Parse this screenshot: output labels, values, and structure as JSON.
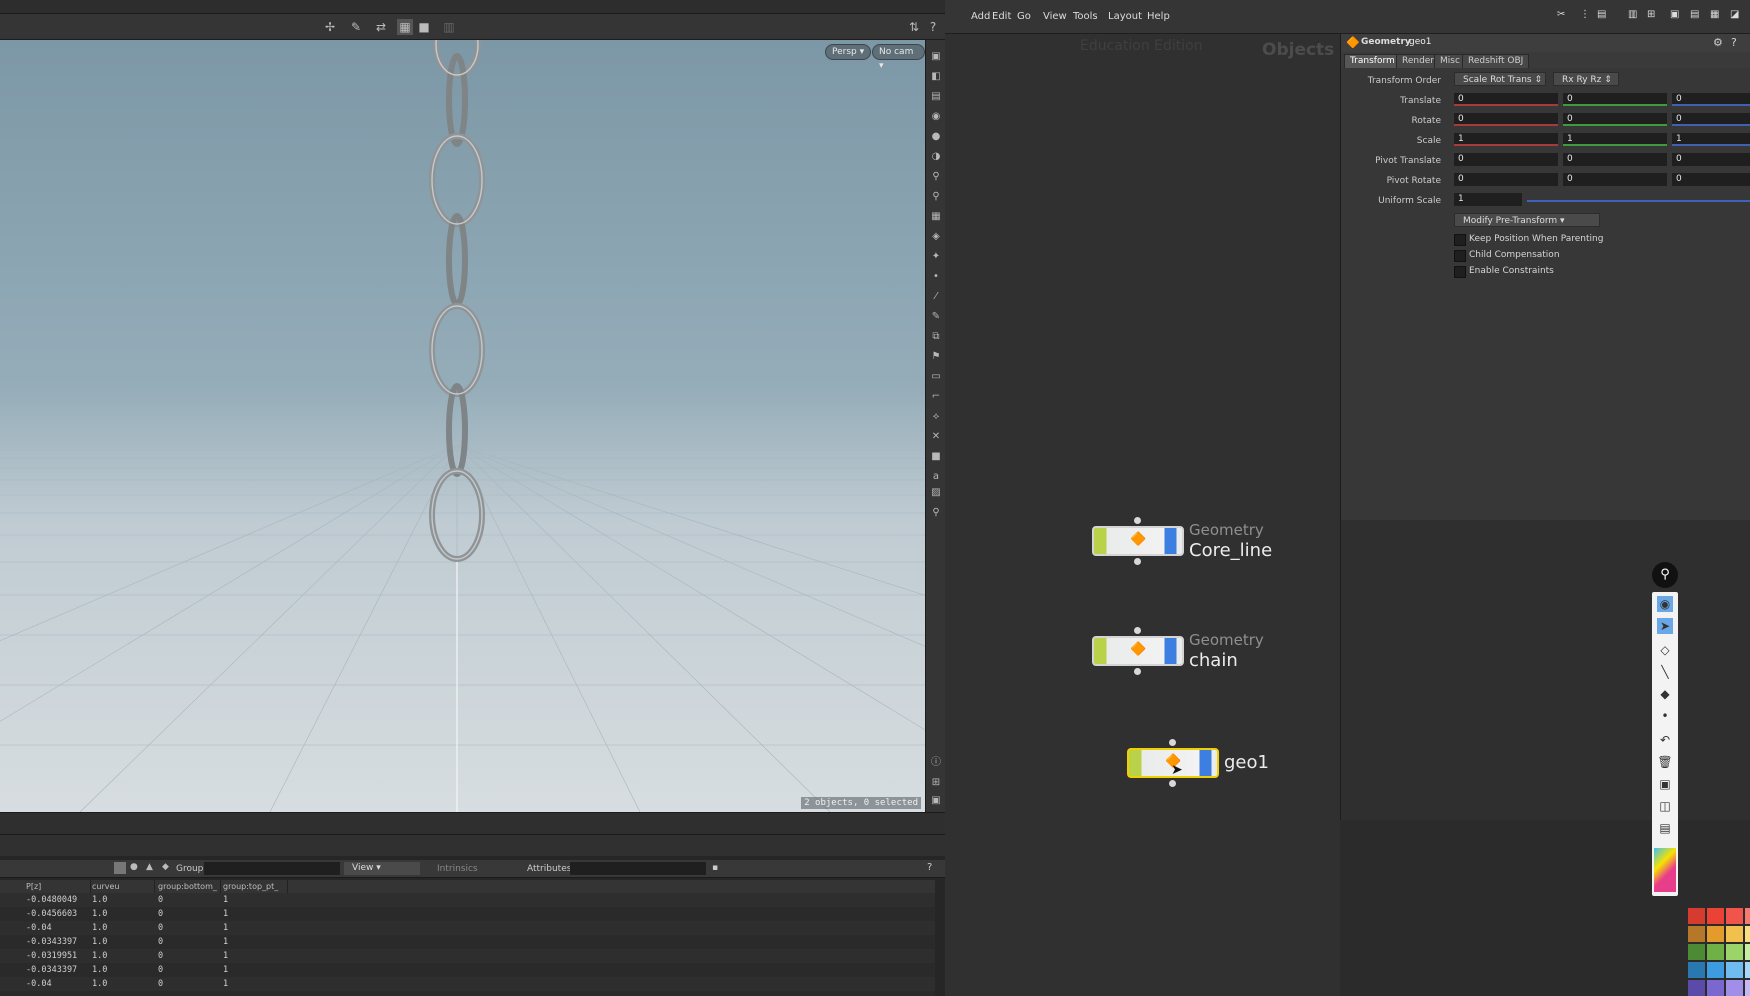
{
  "viewport": {
    "camera_persp": "Persp",
    "camera_nocam": "No cam",
    "status": "2 objects, 0 selected"
  },
  "spreadsheet": {
    "group_label": "Group:",
    "view_label": "View",
    "intrinsics_label": "Intrinsics",
    "attributes_label": "Attributes:",
    "columns": [
      "P[z]",
      "curveu",
      "group:bottom_",
      "group:top_pt_"
    ],
    "rows": [
      [
        "-0.0480049",
        "1.0",
        "0",
        "1"
      ],
      [
        "-0.0456603",
        "1.0",
        "0",
        "1"
      ],
      [
        "-0.04",
        "1.0",
        "0",
        "1"
      ],
      [
        "-0.0343397",
        "1.0",
        "0",
        "1"
      ],
      [
        "-0.0319951",
        "1.0",
        "0",
        "1"
      ],
      [
        "-0.0343397",
        "1.0",
        "0",
        "1"
      ],
      [
        "-0.04",
        "1.0",
        "0",
        "1"
      ]
    ]
  },
  "menu": [
    "Add",
    "Edit",
    "Go",
    "View",
    "Tools",
    "Layout",
    "Help"
  ],
  "network": {
    "watermark": "Education Edition",
    "context": "Objects",
    "nodes": [
      {
        "type": "Geometry",
        "name": "Core_line"
      },
      {
        "type": "Geometry",
        "name": "chain"
      },
      {
        "type": "",
        "name": "geo1"
      }
    ]
  },
  "params": {
    "node_type": "Geometry",
    "node_name": "geo1",
    "tabs": [
      "Transform",
      "Render",
      "Misc",
      "Redshift OBJ"
    ],
    "transform_order_label": "Transform Order",
    "transform_order": "Scale Rot Trans",
    "rotate_order": "Rx Ry Rz",
    "rows": [
      {
        "label": "Translate",
        "x": "0",
        "y": "0",
        "z": "0"
      },
      {
        "label": "Rotate",
        "x": "0",
        "y": "0",
        "z": "0"
      },
      {
        "label": "Scale",
        "x": "1",
        "y": "1",
        "z": "1"
      },
      {
        "label": "Pivot Translate",
        "x": "0",
        "y": "0",
        "z": "0"
      },
      {
        "label": "Pivot Rotate",
        "x": "0",
        "y": "0",
        "z": "0"
      }
    ],
    "uniform_scale_label": "Uniform Scale",
    "uniform_scale": "1",
    "modify_pretransform": "Modify Pre-Transform",
    "checks": [
      "Keep Position When Parenting",
      "Child Compensation",
      "Enable Constraints"
    ]
  },
  "colors": {
    "node_green": "#b9d24a",
    "node_blue": "#3d7fe0",
    "selected_outline": "#f0d000",
    "viewport_sky": "#7c97a6"
  }
}
